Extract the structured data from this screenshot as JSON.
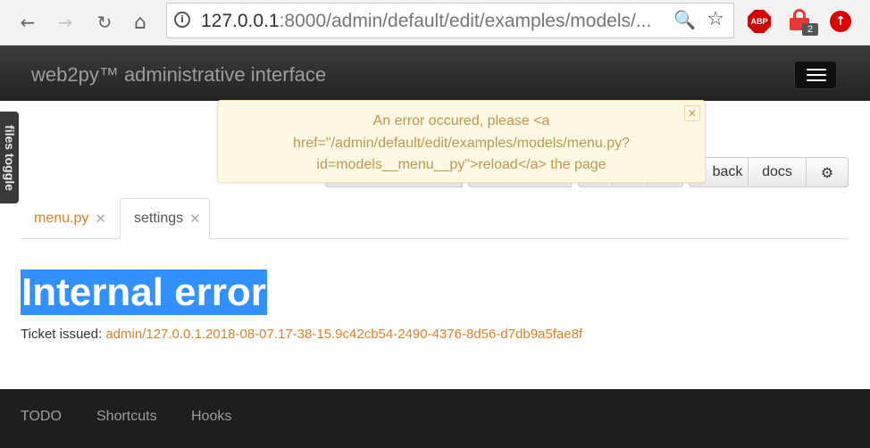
{
  "browser": {
    "url_host": "127.0.0.1",
    "url_rest": ":8000/admin/default/edit/examples/models/...",
    "abp_label": "ABP",
    "lock_badge": "2",
    "back_glyph": "←",
    "forward_glyph": "→",
    "reload_glyph": "↻",
    "home_glyph": "⌂",
    "zoom_glyph": "🔍",
    "star_glyph": "☆",
    "info_glyph": "i",
    "up_glyph": "↑"
  },
  "navbar": {
    "brand": "web2py™ administrative interface"
  },
  "sidebar": {
    "files_toggle": "files toggle"
  },
  "toolbar": {
    "back_label": "back",
    "docs_label": "docs",
    "gear_glyph": "⚙"
  },
  "flash": {
    "message": "An error occured, please <a href=\"/admin/default/edit/examples/models/menu.py?id=models__menu__py\">reload</a> the page",
    "close": "×"
  },
  "tabs": [
    {
      "label": "menu.py",
      "close": "✕",
      "active": false
    },
    {
      "label": "settings",
      "close": "✕",
      "active": true
    }
  ],
  "content": {
    "title": "Internal error",
    "ticket_label": "Ticket issued:",
    "ticket_link": "admin/127.0.0.1.2018-08-07.17-38-15.9c42cb54-2490-4376-8d56-d7db9a5fae8f"
  },
  "footer": {
    "links": [
      "TODO",
      "Shortcuts",
      "Hooks"
    ]
  },
  "colors": {
    "link": "#d9822b",
    "flash_text": "#c09853",
    "flash_bg": "#fcf8e3",
    "selection": "#3390ff"
  }
}
